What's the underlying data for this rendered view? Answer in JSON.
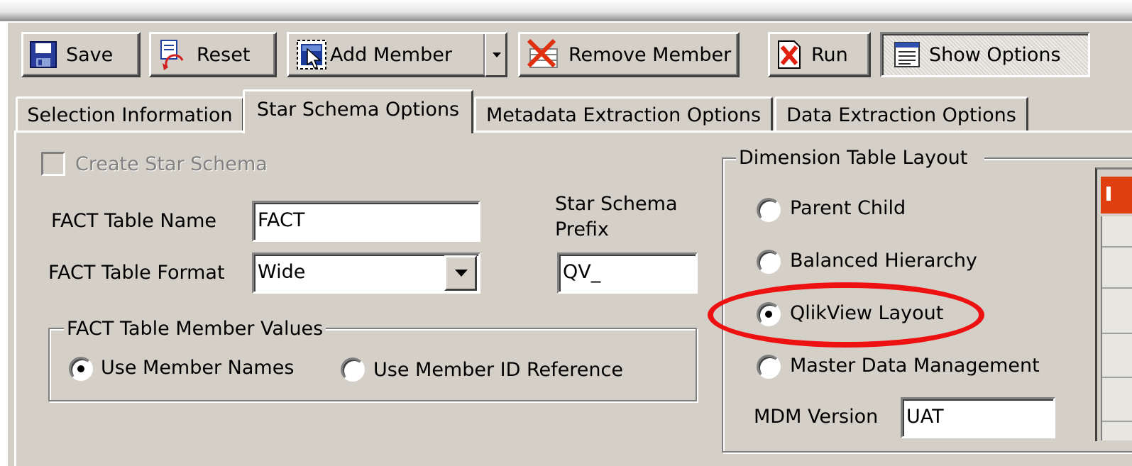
{
  "toolbar": {
    "save_label": "Save",
    "reset_label": "Reset",
    "add_member_label": "Add Member",
    "remove_member_label": "Remove Member",
    "run_label": "Run",
    "show_options_label": "Show Options"
  },
  "tabs": [
    {
      "label": "Selection Information",
      "active": false
    },
    {
      "label": "Star Schema Options",
      "active": true
    },
    {
      "label": "Metadata Extraction Options",
      "active": false
    },
    {
      "label": "Data Extraction Options",
      "active": false
    }
  ],
  "star_schema": {
    "create_checkbox_label": "Create Star Schema",
    "create_checkbox_checked": false,
    "create_checkbox_enabled": false,
    "fact_table_name_label": "FACT Table Name",
    "fact_table_name_value": "FACT",
    "fact_table_format_label": "FACT Table Format",
    "fact_table_format_value": "Wide",
    "prefix_label_line1": "Star Schema",
    "prefix_label_line2": "Prefix",
    "prefix_value": "QV_",
    "member_values_group_title": "FACT Table Member Values",
    "member_values_options": [
      {
        "label": "Use Member Names",
        "selected": true
      },
      {
        "label": "Use Member ID Reference",
        "selected": false
      }
    ]
  },
  "dimension_layout": {
    "group_title": "Dimension Table Layout",
    "options": [
      {
        "label": "Parent Child",
        "selected": false
      },
      {
        "label": "Balanced Hierarchy",
        "selected": false
      },
      {
        "label": "QlikView Layout",
        "selected": true
      },
      {
        "label": "Master Data Management",
        "selected": false
      }
    ],
    "mdm_version_label": "MDM Version",
    "mdm_version_value": "UAT"
  },
  "colors": {
    "window_bg": "#d4d0c8",
    "highlight": "#ee1111"
  }
}
